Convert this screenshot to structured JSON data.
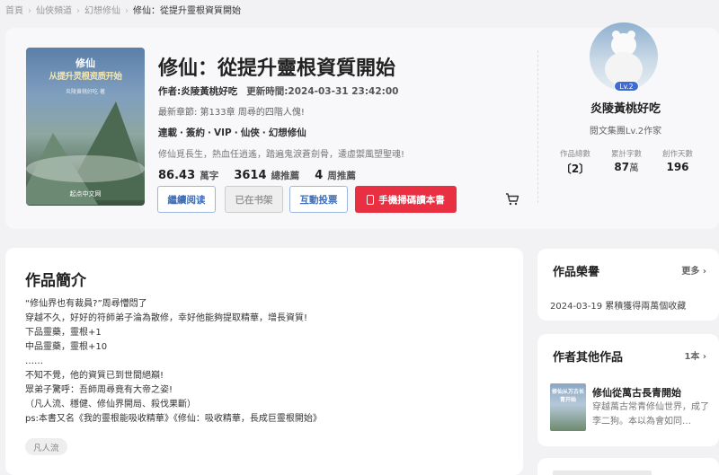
{
  "breadcrumb": {
    "items": [
      "首頁",
      "仙俠頻道",
      "幻想修仙"
    ],
    "current": "修仙：從提升靈根資質開始",
    "separator": "›"
  },
  "book": {
    "cover": {
      "line1": "修仙",
      "line2": "从提升灵根资质开始",
      "line3": "炎陵黄桃好吃 著",
      "line4": "起点中文网"
    },
    "title": "修仙：從提升靈根資質開始",
    "author_label": "作者:炎陵黃桃好吃",
    "update_label": "更新時間:2024-03-31 23:42:00",
    "latest_chapter": "最新章節: 第133章 周尋的四階人傀!",
    "tags": [
      "連載",
      "簽約",
      "VIP",
      "仙俠",
      "幻想修仙"
    ],
    "blurb": "修仙覓長生，熱血任逍遙，踏遍鬼淚蒼劍骨，逶虛禦風塑聖魂!",
    "stats": [
      {
        "num": "86.43",
        "unit": "萬字"
      },
      {
        "num": "3614",
        "unit": "總推薦"
      },
      {
        "num": "4",
        "unit": "周推薦"
      }
    ],
    "buttons": {
      "read": "繼續阅读",
      "shelf": "已在书架",
      "vote": "互動投票",
      "phone": "手機掃碼讀本書"
    }
  },
  "author": {
    "level_badge": "Lv.2",
    "name": "炎陵黃桃好吃",
    "subtitle": "閱文集團Lv.2作家",
    "stats": [
      {
        "label": "作品總數",
        "value": "2",
        "unit": ""
      },
      {
        "label": "累計字數",
        "value": "87",
        "unit": "萬"
      },
      {
        "label": "創作天數",
        "value": "196",
        "unit": ""
      }
    ]
  },
  "intro": {
    "title": "作品簡介",
    "lines": [
      "“修仙界也有裁員?”周尋懵悶了",
      "穿越不久，好好的符師弟子淪為散修，幸好他能夠提取精華，增長資質!",
      "下品靈藥，靈根+1",
      "中品靈藥，靈根+10",
      "……",
      "不知不覺，他的資質已到世間絕巔!",
      "眾弟子驚呼：吾師周尋竟有大帝之姿!",
      "（凡人流、穩健、修仙界開局、殺伐果斷）",
      "ps:本書又名《我的靈根能吸收精華》《修仙：吸收精華，長成巨靈根開始》"
    ],
    "tag": "凡人流"
  },
  "honor": {
    "title": "作品榮譽",
    "more": "更多 ›",
    "line": "2024-03-19 累積獲得兩萬個收藏"
  },
  "other_works": {
    "title": "作者其他作品",
    "count": "1本 ›",
    "cover_text": "修仙从万古长青开始",
    "work_title": "修仙從萬古長青開始",
    "work_desc": "穿越萬古常青修仙世界，成了李二狗。本以為會如同…"
  },
  "colors": {
    "accent_blue": "#3e6cb4",
    "phone_red": "#e83042",
    "badge_blue": "#3e6cd4"
  }
}
